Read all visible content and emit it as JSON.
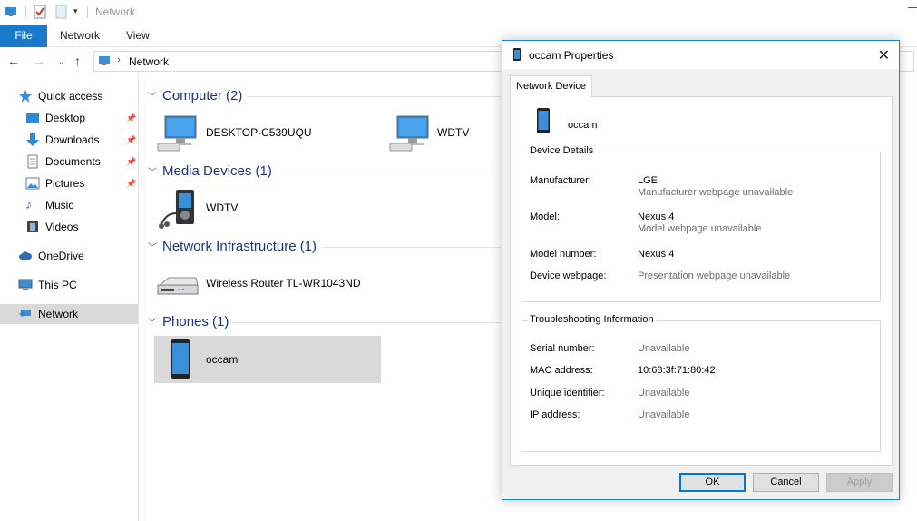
{
  "window": {
    "title": "Network"
  },
  "ribbon": {
    "tabs": [
      "File",
      "Network",
      "View"
    ]
  },
  "address": {
    "path": "Network"
  },
  "sidebar": {
    "quick_access": "Quick access",
    "items": [
      {
        "label": "Desktop",
        "pinned": true
      },
      {
        "label": "Downloads",
        "pinned": true
      },
      {
        "label": "Documents",
        "pinned": true
      },
      {
        "label": "Pictures",
        "pinned": true
      },
      {
        "label": "Music",
        "pinned": false
      },
      {
        "label": "Videos",
        "pinned": false
      }
    ],
    "onedrive": "OneDrive",
    "thispc": "This PC",
    "network": "Network"
  },
  "groups": [
    {
      "header": "Computer (2)",
      "items": [
        "DESKTOP-C539UQU",
        "WDTV"
      ]
    },
    {
      "header": "Media Devices (1)",
      "items": [
        "WDTV"
      ]
    },
    {
      "header": "Network Infrastructure (1)",
      "items": [
        "Wireless Router TL-WR1043ND"
      ]
    },
    {
      "header": "Phones (1)",
      "items": [
        "occam"
      ]
    }
  ],
  "dialog": {
    "title": "occam Properties",
    "tab": "Network Device",
    "device_name": "occam",
    "details": {
      "legend": "Device Details",
      "manufacturer_label": "Manufacturer:",
      "manufacturer_value": "LGE",
      "manufacturer_sub": "Manufacturer webpage unavailable",
      "model_label": "Model:",
      "model_value": "Nexus 4",
      "model_sub": "Model webpage unavailable",
      "model_number_label": "Model number:",
      "model_number_value": "Nexus 4",
      "webpage_label": "Device webpage:",
      "webpage_value": "Presentation webpage unavailable"
    },
    "troubleshooting": {
      "legend": "Troubleshooting Information",
      "serial_label": "Serial number:",
      "serial_value": "Unavailable",
      "mac_label": "MAC address:",
      "mac_value": "10:68:3f:71:80:42",
      "uid_label": "Unique identifier:",
      "uid_value": "Unavailable",
      "ip_label": "IP address:",
      "ip_value": "Unavailable"
    },
    "buttons": {
      "ok": "OK",
      "cancel": "Cancel",
      "apply": "Apply"
    }
  },
  "colors": {
    "accent": "#1979ca",
    "header_blue": "#1e3287",
    "dialog_border": "#1883d7"
  }
}
